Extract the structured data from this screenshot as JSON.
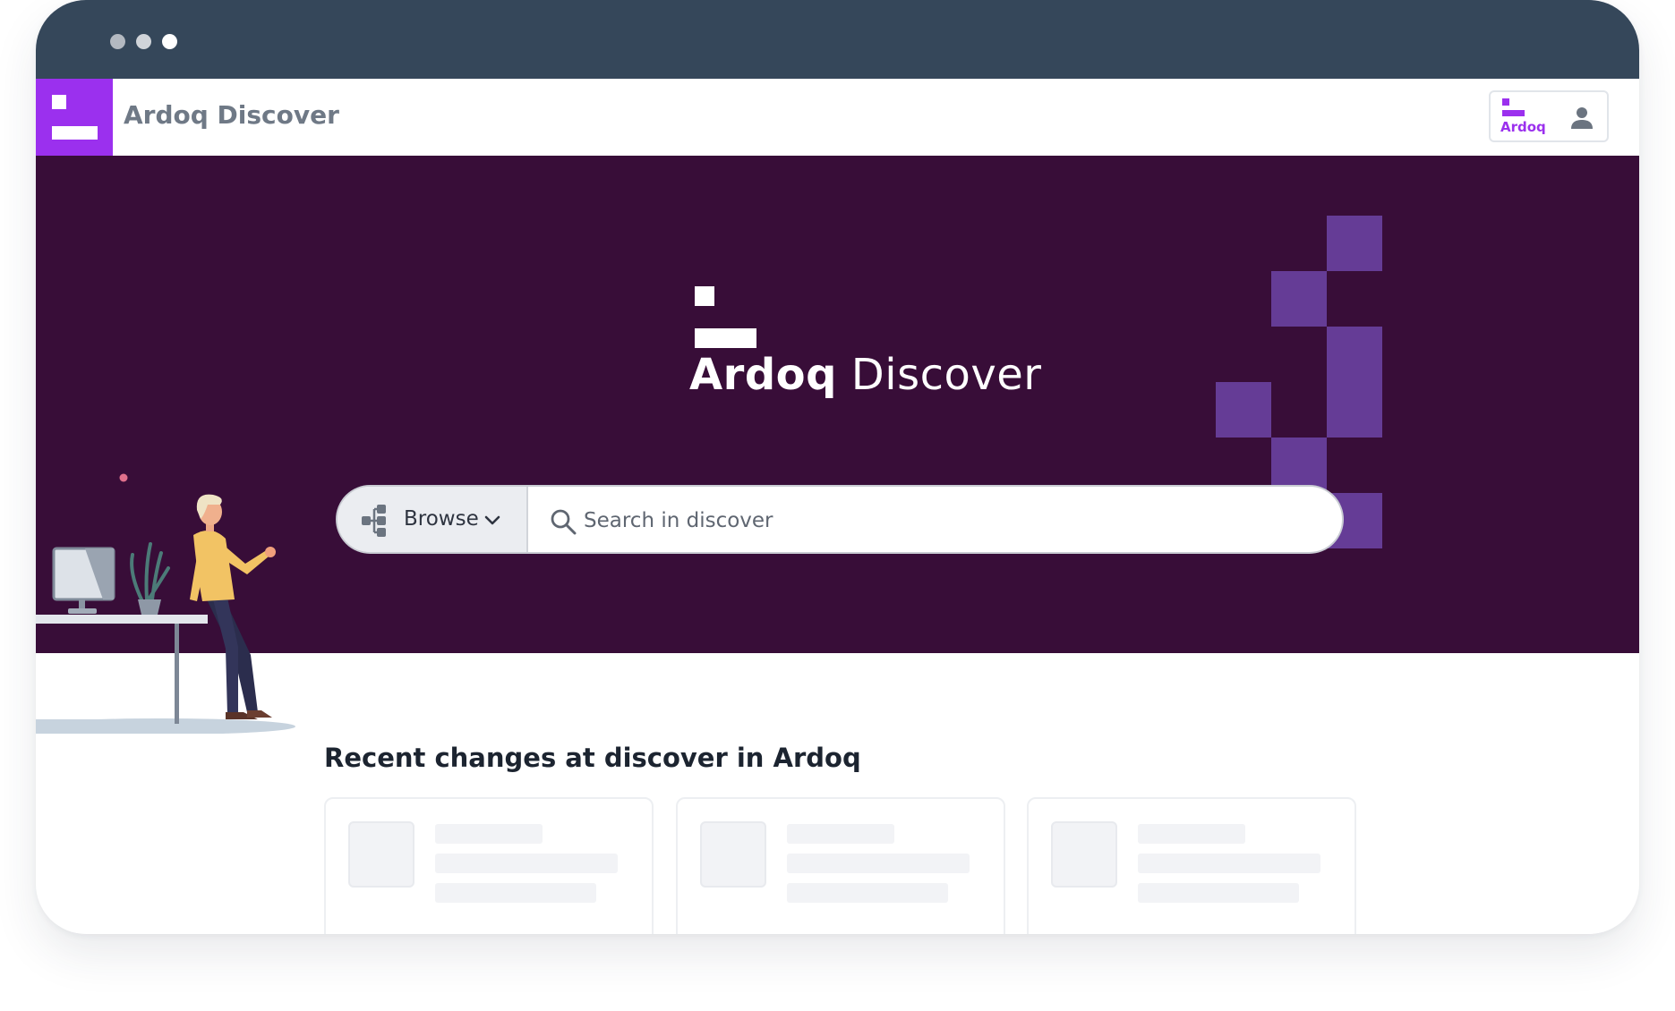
{
  "window": {
    "controls": [
      "close-dot",
      "minimize-dot",
      "maximize-dot"
    ]
  },
  "app_bar": {
    "title": "Ardoq Discover",
    "app_switcher_label": "Ardoq",
    "brand_color": "#9b30ee"
  },
  "hero": {
    "title_bold": "Ardoq",
    "title_regular": "Discover",
    "background_color": "#380d38",
    "accent_block_color": "#653c96"
  },
  "search": {
    "browse_label": "Browse",
    "placeholder": "Search in discover",
    "value": ""
  },
  "recent": {
    "heading": "Recent changes at discover in Ardoq",
    "cards": [
      {
        "state": "loading"
      },
      {
        "state": "loading"
      },
      {
        "state": "loading"
      }
    ]
  },
  "icons": [
    "ardoq-logo-icon",
    "user-icon",
    "browse-hierarchy-icon",
    "chevron-down-icon",
    "search-icon"
  ]
}
